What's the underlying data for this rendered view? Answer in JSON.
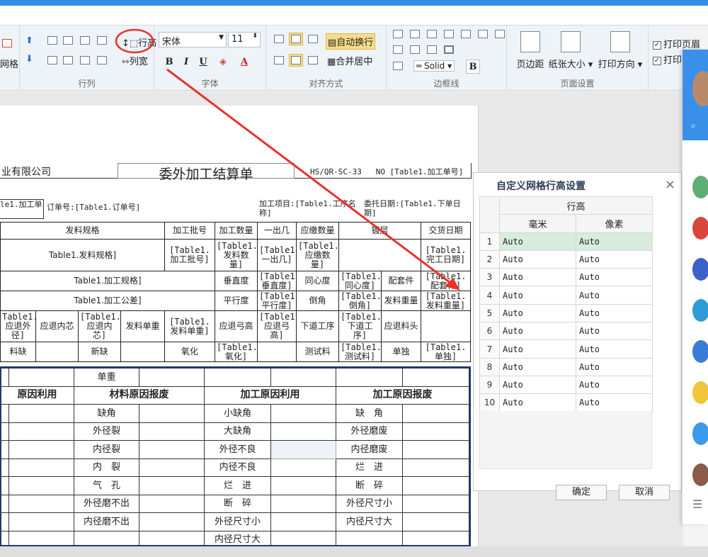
{
  "ribbon": {
    "left_label": "网格",
    "groups": {
      "row_col": "行列",
      "font": "字体",
      "align": "对齐方式",
      "border": "边框线",
      "page": "页面设置"
    },
    "row_height_btn": "行高",
    "col_width_btn": "列宽",
    "font_name": "宋体",
    "font_size": "11",
    "bold": "B",
    "italic": "I",
    "underline": "U",
    "wrap_btn": "自动换行",
    "merge_btn": "合并居中",
    "border_style": "Solid",
    "border_bold": "B",
    "margin_btn": "页边距",
    "paper_btn": "纸张大小",
    "orient_btn": "打印方向",
    "check1": "打印页眉",
    "check2": "打印"
  },
  "sheet": {
    "company": "业有限公司",
    "title": "委外加工结算单",
    "code": "HS/QR-SC-33",
    "no": "NO [Table1.加工单号]",
    "processing_no": "le1.加工单",
    "order_no": "订单号:[Table1.订单号]",
    "item": "加工项目:[Table1.工序名称]",
    "date": "委托日期:[Table1.下单日期]",
    "header_row": [
      "发料规格",
      "加工批号",
      "加工数量",
      "一出几",
      "应缴数量",
      "镀层",
      "交货日期"
    ],
    "row2": [
      "Table1.发料规格]",
      "[Table1.加工批号]",
      "[Table1.发料数量]",
      "[Table1.一出几]",
      "[Table1.应缴数量]",
      "[Table1.完工日期]"
    ],
    "row3": [
      "Table1.加工规格]",
      "垂直度",
      "[Table1.垂直度]",
      "同心度",
      "[Table1.同心度]",
      "配套件",
      "[Table1.配套件]"
    ],
    "row4": [
      "Table1.加工公差]",
      "平行度",
      "[Table1.平行度]",
      "倒角",
      "[Table1.倒角]",
      "发料重量",
      "[Table1.发料重量]"
    ],
    "row5": [
      "Table1.应退外径]",
      "应退内芯",
      "[Table1.应退内芯]",
      "发料单重",
      "[Table1.发料单重]",
      "应退弓高",
      "[Table1.应退弓高]",
      "下道工序",
      "[Table1.下道工序]",
      "应退料头"
    ],
    "row6": [
      "料缺",
      "新缺",
      "氧化",
      "[Table1.氧化]",
      "测试料",
      "[Table1.测试料]",
      "单独",
      "[Table1.单独]"
    ]
  },
  "bottom": {
    "unit_weight": "单重",
    "headers": [
      "原因利用",
      "材料原因报废",
      "加工原因利用",
      "加工原因报废"
    ],
    "col_material_scrap": [
      "缺角",
      "外径裂",
      "内径裂",
      "内　裂",
      "气　孔",
      "外径磨不出",
      "内径磨不出"
    ],
    "col_process_use": [
      "小缺角",
      "大缺角",
      "外径不良",
      "内径不良",
      "烂　进",
      "断　碎",
      "外径尺寸小",
      "内径尺寸大"
    ],
    "col_process_scrap": [
      "缺　角",
      "外径磨废",
      "内径磨废",
      "烂　进",
      "断　碎",
      "外径尺寸小",
      "内径尺寸大"
    ]
  },
  "dialog": {
    "title": "自定义网格行高设置",
    "close": "×",
    "group_header": "行高",
    "col_mm": "毫米",
    "col_px": "像素",
    "rows": [
      {
        "n": "1",
        "mm": "Auto",
        "px": "Auto"
      },
      {
        "n": "2",
        "mm": "Auto",
        "px": "Auto"
      },
      {
        "n": "3",
        "mm": "Auto",
        "px": "Auto"
      },
      {
        "n": "4",
        "mm": "Auto",
        "px": "Auto"
      },
      {
        "n": "5",
        "mm": "Auto",
        "px": "Auto"
      },
      {
        "n": "6",
        "mm": "Auto",
        "px": "Auto"
      },
      {
        "n": "7",
        "mm": "Auto",
        "px": "Auto"
      },
      {
        "n": "8",
        "mm": "Auto",
        "px": "Auto"
      },
      {
        "n": "9",
        "mm": "Auto",
        "px": "Auto"
      },
      {
        "n": "10",
        "mm": "Auto",
        "px": "Auto"
      }
    ],
    "ok": "确定",
    "cancel": "取消"
  },
  "colors": {
    "accent": "#2f8fe6",
    "annotation": "#e8322b",
    "selected_row": "#d7ecdc",
    "frame": "#1e3d6a"
  }
}
